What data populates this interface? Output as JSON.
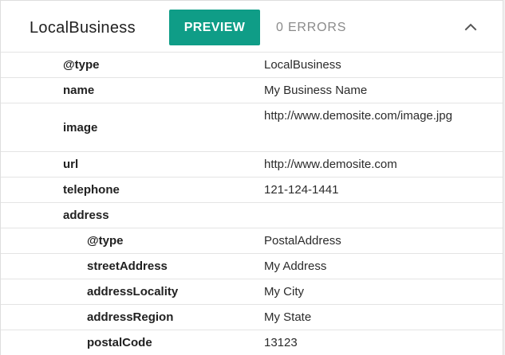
{
  "header": {
    "title": "LocalBusiness",
    "preview_label": "PREVIEW",
    "errors_label": "0 ERRORS",
    "collapse_icon": "chevron-up-icon"
  },
  "properties": [
    {
      "key": "@type",
      "value": "LocalBusiness",
      "level": 0
    },
    {
      "key": "name",
      "value": "My Business Name",
      "level": 0
    },
    {
      "key": "image",
      "value": "http://www.demosite.com/image.jpg",
      "level": 0
    },
    {
      "key": "url",
      "value": "http://www.demosite.com",
      "level": 0
    },
    {
      "key": "telephone",
      "value": "121-124-1441",
      "level": 0
    },
    {
      "key": "address",
      "value": "",
      "level": 0
    },
    {
      "key": "@type",
      "value": "PostalAddress",
      "level": 1
    },
    {
      "key": "streetAddress",
      "value": "My Address",
      "level": 1
    },
    {
      "key": "addressLocality",
      "value": "My City",
      "level": 1
    },
    {
      "key": "addressRegion",
      "value": "My State",
      "level": 1
    },
    {
      "key": "postalCode",
      "value": "13123",
      "level": 1
    }
  ],
  "colors": {
    "accent": "#0f9d87",
    "errors_text": "#8a8a8a",
    "divider": "#e4e4e4"
  }
}
